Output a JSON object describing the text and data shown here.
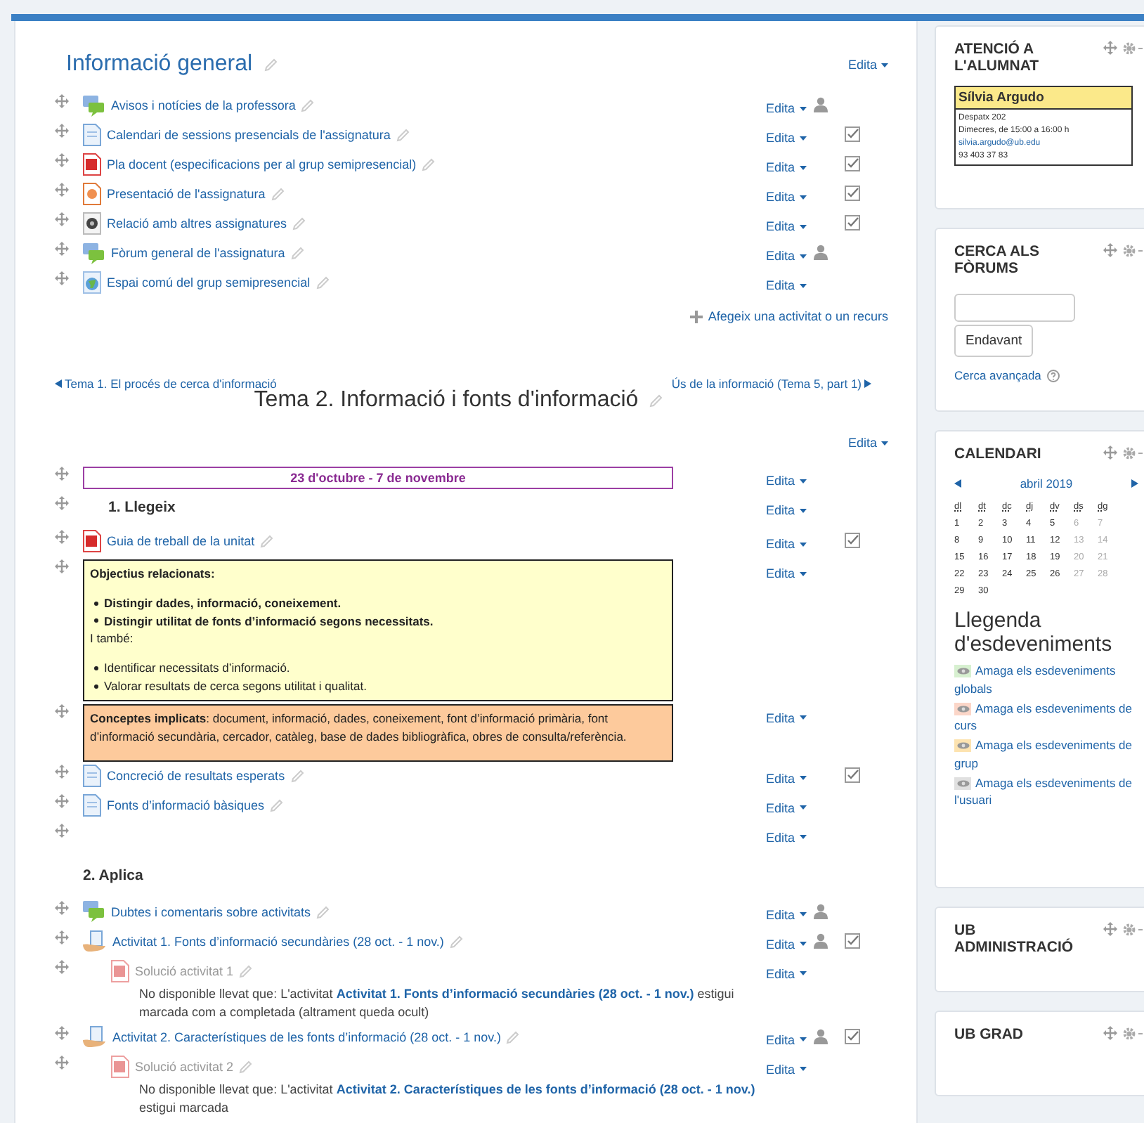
{
  "sections": [
    {
      "title": "Informació general",
      "edit": "Edita",
      "items": [
        {
          "kind": "forum",
          "label": "Avisos i notícies de la professora",
          "edit": "Edita",
          "groups": true,
          "completion": false,
          "dimmed": false
        },
        {
          "kind": "page",
          "label": "Calendari de sessions presencials de l'assignatura",
          "edit": "Edita",
          "groups": false,
          "completion": true,
          "dimmed": false
        },
        {
          "kind": "pdf",
          "label": "Pla docent (especificacions per al grup semipresencial)",
          "edit": "Edita",
          "groups": false,
          "completion": true,
          "dimmed": false
        },
        {
          "kind": "slides",
          "label": "Presentació de l'assignatura",
          "edit": "Edita",
          "groups": false,
          "completion": true,
          "dimmed": false
        },
        {
          "kind": "disc",
          "label": "Relació amb altres assignatures",
          "edit": "Edita",
          "groups": false,
          "completion": true,
          "dimmed": false
        },
        {
          "kind": "forum",
          "label": "Fòrum general de l'assignatura",
          "edit": "Edita",
          "groups": true,
          "completion": false,
          "dimmed": false
        },
        {
          "kind": "globe",
          "label": "Espai comú del grup semipresencial",
          "edit": "Edita",
          "groups": false,
          "completion": false,
          "dimmed": false
        }
      ],
      "add": "Afegeix una activitat o un recurs"
    },
    {
      "title": "Tema 2. Informació i fonts d'informació",
      "prev": "Tema 1. El procés de cerca d'informació",
      "next": "Ús de la informació (Tema 5, part 1)",
      "edit": "Edita",
      "items": [
        {
          "kind": "datebox",
          "text": "23 d'octubre - 7 de novembre",
          "edit": "Edita"
        },
        {
          "kind": "heading",
          "text": "1. Llegeix",
          "movable": true,
          "edit": "Edita"
        },
        {
          "kind": "pdf",
          "label": "Guia de treball de la unitat",
          "edit": "Edita",
          "groups": false,
          "completion": true,
          "dimmed": false
        },
        {
          "kind": "objectives",
          "title": "Objectius relacionats:",
          "strong_points": [
            "Distingir dades, informació, coneixement.",
            "Distingir utilitat de fonts d’informació segons necessitats."
          ],
          "middle": "I també:",
          "points": [
            "Identificar necessitats d’informació.",
            "Valorar resultats de cerca segons utilitat i qualitat."
          ],
          "edit": "Edita"
        },
        {
          "kind": "concepts",
          "label": "Conceptes implicats",
          "text": ": document, informació, dades, coneixement, font d’informació primària, font d’informació secundària, cercador, catàleg, base de dades bibliogràfica, obres de consulta/referència.",
          "edit": "Edita"
        },
        {
          "kind": "page",
          "label": "Concreció de resultats esperats",
          "edit": "Edita",
          "groups": false,
          "completion": true,
          "dimmed": false
        },
        {
          "kind": "page",
          "label": "Fonts d’informació bàsiques",
          "edit": "Edita",
          "groups": false,
          "completion": false,
          "dimmed": false
        },
        {
          "kind": "empty",
          "edit": "Edita"
        },
        {
          "kind": "heading",
          "text": "2. Aplica",
          "movable": false
        },
        {
          "kind": "forum",
          "label": "Dubtes i comentaris sobre activitats",
          "edit": "Edita",
          "groups": true,
          "completion": false,
          "dimmed": false
        },
        {
          "kind": "assign",
          "label": "Activitat 1. Fonts d’informació secundàries (28 oct. - 1 nov.)",
          "edit": "Edita",
          "groups": true,
          "completion": true,
          "dimmed": false,
          "children": [
            {
              "kind": "pdf",
              "label": "Solució activitat 1",
              "edit": "Edita",
              "groups": false,
              "completion": false,
              "dimmed": true,
              "note": {
                "before": "No disponible llevat que: L'activitat",
                "link": "Activitat 1. Fonts d’informació secundàries (28 oct. - 1 nov.)",
                "after": "estigui marcada com a completada (altrament queda ocult)"
              }
            }
          ]
        },
        {
          "kind": "assign",
          "label": "Activitat 2. Característiques de les fonts d’informació (28 oct. - 1 nov.)",
          "edit": "Edita",
          "groups": true,
          "completion": true,
          "dimmed": false,
          "children": [
            {
              "kind": "pdf",
              "label": "Solució activitat 2",
              "edit": "Edita",
              "groups": false,
              "completion": false,
              "dimmed": true,
              "note": {
                "before": "No disponible llevat que: L'activitat",
                "link": "Activitat 2. Característiques de les fonts d’informació (28 oct. - 1 nov.)",
                "after": "estigui marcada"
              }
            }
          ]
        }
      ]
    }
  ],
  "blocks": [
    {
      "kind": "contact",
      "title": "ATENCIÓ A L'ALUMNAT",
      "name": "Sílvia Argudo",
      "lines": [
        "Despatx 202",
        "Dimecres, de 15:00 a 16:00 h"
      ],
      "email": "silvia.argudo@ub.edu",
      "phone": "93 403 37 83"
    },
    {
      "kind": "search",
      "title": "CERCA ALS FÒRUMS",
      "button": "Endavant",
      "link": "Cerca avançada"
    },
    {
      "kind": "calendar",
      "title": "CALENDARI",
      "month": "abril 2019",
      "weekdays": [
        "dl",
        "dt",
        "dc",
        "dj",
        "dv",
        "ds",
        "dg"
      ],
      "weeks": [
        [
          {
            "day": "1",
            "weekend": false
          },
          {
            "day": "2",
            "weekend": false
          },
          {
            "day": "3",
            "weekend": false
          },
          {
            "day": "4",
            "weekend": false
          },
          {
            "day": "5",
            "weekend": false
          },
          {
            "day": "6",
            "weekend": true
          },
          {
            "day": "7",
            "weekend": true
          }
        ],
        [
          {
            "day": "8",
            "weekend": false
          },
          {
            "day": "9",
            "weekend": false
          },
          {
            "day": "10",
            "weekend": false
          },
          {
            "day": "11",
            "weekend": false
          },
          {
            "day": "12",
            "weekend": false
          },
          {
            "day": "13",
            "weekend": true
          },
          {
            "day": "14",
            "weekend": true
          }
        ],
        [
          {
            "day": "15",
            "weekend": false
          },
          {
            "day": "16",
            "weekend": false
          },
          {
            "day": "17",
            "weekend": false
          },
          {
            "day": "18",
            "weekend": false
          },
          {
            "day": "19",
            "weekend": false
          },
          {
            "day": "20",
            "weekend": true
          },
          {
            "day": "21",
            "weekend": true
          }
        ],
        [
          {
            "day": "22",
            "weekend": false
          },
          {
            "day": "23",
            "weekend": false
          },
          {
            "day": "24",
            "weekend": false
          },
          {
            "day": "25",
            "weekend": false
          },
          {
            "day": "26",
            "weekend": false
          },
          {
            "day": "27",
            "weekend": true
          },
          {
            "day": "28",
            "weekend": true
          }
        ],
        [
          {
            "day": "29",
            "weekend": false
          },
          {
            "day": "30",
            "weekend": false
          }
        ]
      ],
      "legend_title": "Llegenda d'esdeveniments",
      "legend": [
        {
          "text": "Amaga els esdeveniments globals",
          "color": "#d7f0d0"
        },
        {
          "text": "Amaga els esdeveniments de curs",
          "color": "#fbd6c8"
        },
        {
          "text": "Amaga els esdeveniments de grup",
          "color": "#fde3b0"
        },
        {
          "text": "Amaga els esdeveniments de l'usuari",
          "color": "#e0e0e0"
        }
      ]
    },
    {
      "kind": "empty",
      "title": "UB ADMINISTRACIÓ"
    },
    {
      "kind": "empty",
      "title": "UB GRAD"
    }
  ]
}
